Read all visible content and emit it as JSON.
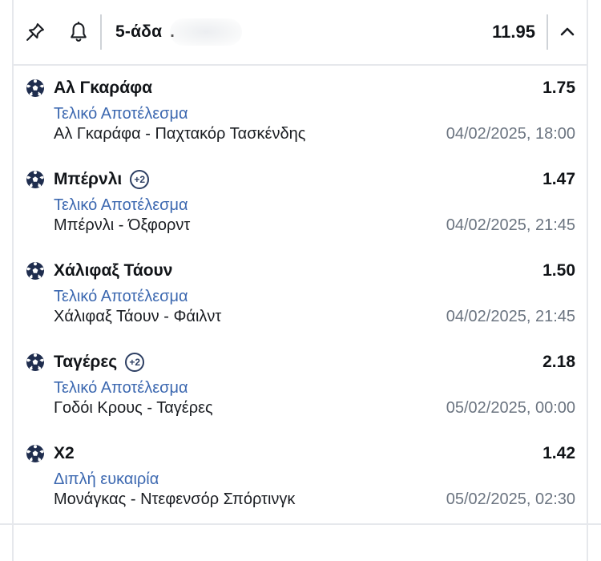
{
  "header": {
    "slip_type": "5-άδα",
    "name_fragment": ".",
    "total_odds": "11.95"
  },
  "icons": {
    "pin": "pin-icon",
    "bell": "bell-icon",
    "collapse": "chevron-up-icon",
    "sport": "soccer-ball-icon"
  },
  "colors": {
    "market_text": "#3c68b0",
    "badge": "#2c3e62",
    "datetime_text": "#6b7480",
    "divider": "#e6e8ec"
  },
  "selections": [
    {
      "pick": "Αλ Γκαράφα",
      "badge": "",
      "odds": "1.75",
      "market": "Τελικό Αποτέλεσμα",
      "match": "Αλ Γκαράφα - Παχτακόρ Τασκένδης",
      "datetime": "04/02/2025, 18:00"
    },
    {
      "pick": "Μπέρνλι",
      "badge": "+2",
      "odds": "1.47",
      "market": "Τελικό Αποτέλεσμα",
      "match": "Μπέρνλι - Όξφορντ",
      "datetime": "04/02/2025, 21:45"
    },
    {
      "pick": "Χάλιφαξ Τάουν",
      "badge": "",
      "odds": "1.50",
      "market": "Τελικό Αποτέλεσμα",
      "match": "Χάλιφαξ Τάουν - Φάιλντ",
      "datetime": "04/02/2025, 21:45"
    },
    {
      "pick": "Ταγέρες",
      "badge": "+2",
      "odds": "2.18",
      "market": "Τελικό Αποτέλεσμα",
      "match": "Γοδόι Κρους - Ταγέρες",
      "datetime": "05/02/2025, 00:00"
    },
    {
      "pick": "Χ2",
      "badge": "",
      "odds": "1.42",
      "market": "Διπλή ευκαιρία",
      "match": "Μονάγκας - Ντεφενσόρ Σπόρτινγκ",
      "datetime": "05/02/2025, 02:30"
    }
  ]
}
